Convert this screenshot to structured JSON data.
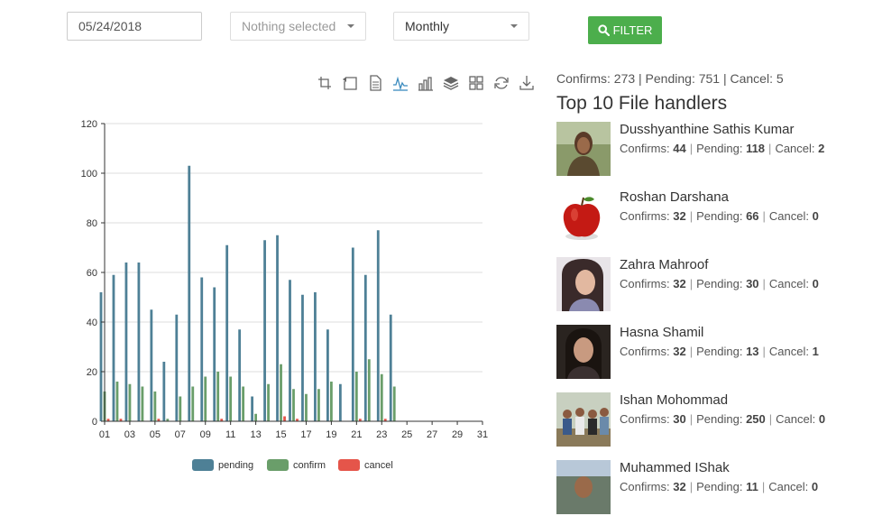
{
  "filters": {
    "date_value": "05/24/2018",
    "status_select": "Nothing selected",
    "period_select": "Monthly",
    "filter_label": "FILTER"
  },
  "toolbox_icons": [
    "zoom-icon",
    "zoom-reset-icon",
    "data-view-icon",
    "line-chart-icon",
    "bar-chart-icon",
    "stack-icon",
    "tiled-icon",
    "restore-icon",
    "download-icon"
  ],
  "colors": {
    "pending": "#4e8096",
    "confirm": "#6a9e6a",
    "cancel": "#e5554a",
    "accent": "#4cae4c"
  },
  "chart_data": {
    "type": "bar",
    "categories": [
      "01",
      "02",
      "03",
      "04",
      "05",
      "06",
      "07",
      "08",
      "09",
      "10",
      "11",
      "12",
      "13",
      "14",
      "15",
      "16",
      "17",
      "18",
      "19",
      "20",
      "21",
      "22",
      "23",
      "24",
      "25",
      "26",
      "27",
      "28",
      "29",
      "30",
      "31"
    ],
    "x_tick_labels": [
      "01",
      "03",
      "05",
      "07",
      "09",
      "11",
      "13",
      "15",
      "17",
      "19",
      "21",
      "23",
      "25",
      "27",
      "29",
      "31"
    ],
    "ylim": [
      0,
      120
    ],
    "y_ticks": [
      0,
      20,
      40,
      60,
      80,
      100,
      120
    ],
    "legend_position": "bottom-center",
    "series": [
      {
        "name": "pending",
        "values": [
          52,
          59,
          64,
          64,
          45,
          24,
          43,
          103,
          58,
          54,
          71,
          37,
          10,
          73,
          75,
          57,
          51,
          52,
          37,
          15,
          70,
          59,
          77,
          43,
          0,
          0,
          0,
          0,
          0,
          0,
          0
        ]
      },
      {
        "name": "confirm",
        "values": [
          12,
          16,
          15,
          14,
          12,
          1,
          10,
          14,
          18,
          20,
          18,
          14,
          3,
          15,
          23,
          13,
          11,
          13,
          16,
          0,
          20,
          25,
          19,
          14,
          0,
          0,
          0,
          0,
          0,
          0,
          0
        ]
      },
      {
        "name": "cancel",
        "values": [
          1,
          1,
          0,
          0,
          1,
          0,
          0,
          0,
          0,
          1,
          0,
          0,
          0,
          0,
          2,
          1,
          0,
          0,
          0,
          0,
          1,
          0,
          1,
          0,
          0,
          0,
          0,
          0,
          0,
          0,
          0
        ]
      }
    ]
  },
  "summary": {
    "text": "Confirms: 273 | Pending: 751 | Cancel: 5"
  },
  "handlers": {
    "title": "Top 10 File handlers",
    "confirms_label": "Confirms:",
    "pending_label": "Pending:",
    "cancel_label": "Cancel:",
    "items": [
      {
        "name": "Dusshyanthine Sathis Kumar",
        "confirms": 44,
        "pending": 118,
        "cancel": 2
      },
      {
        "name": "Roshan Darshana",
        "confirms": 32,
        "pending": 66,
        "cancel": 0
      },
      {
        "name": "Zahra Mahroof",
        "confirms": 32,
        "pending": 30,
        "cancel": 0
      },
      {
        "name": "Hasna Shamil",
        "confirms": 32,
        "pending": 13,
        "cancel": 1
      },
      {
        "name": "Ishan Mohommad",
        "confirms": 30,
        "pending": 250,
        "cancel": 0
      },
      {
        "name": "Muhammed IShak",
        "confirms": 32,
        "pending": 11,
        "cancel": 0
      }
    ]
  }
}
